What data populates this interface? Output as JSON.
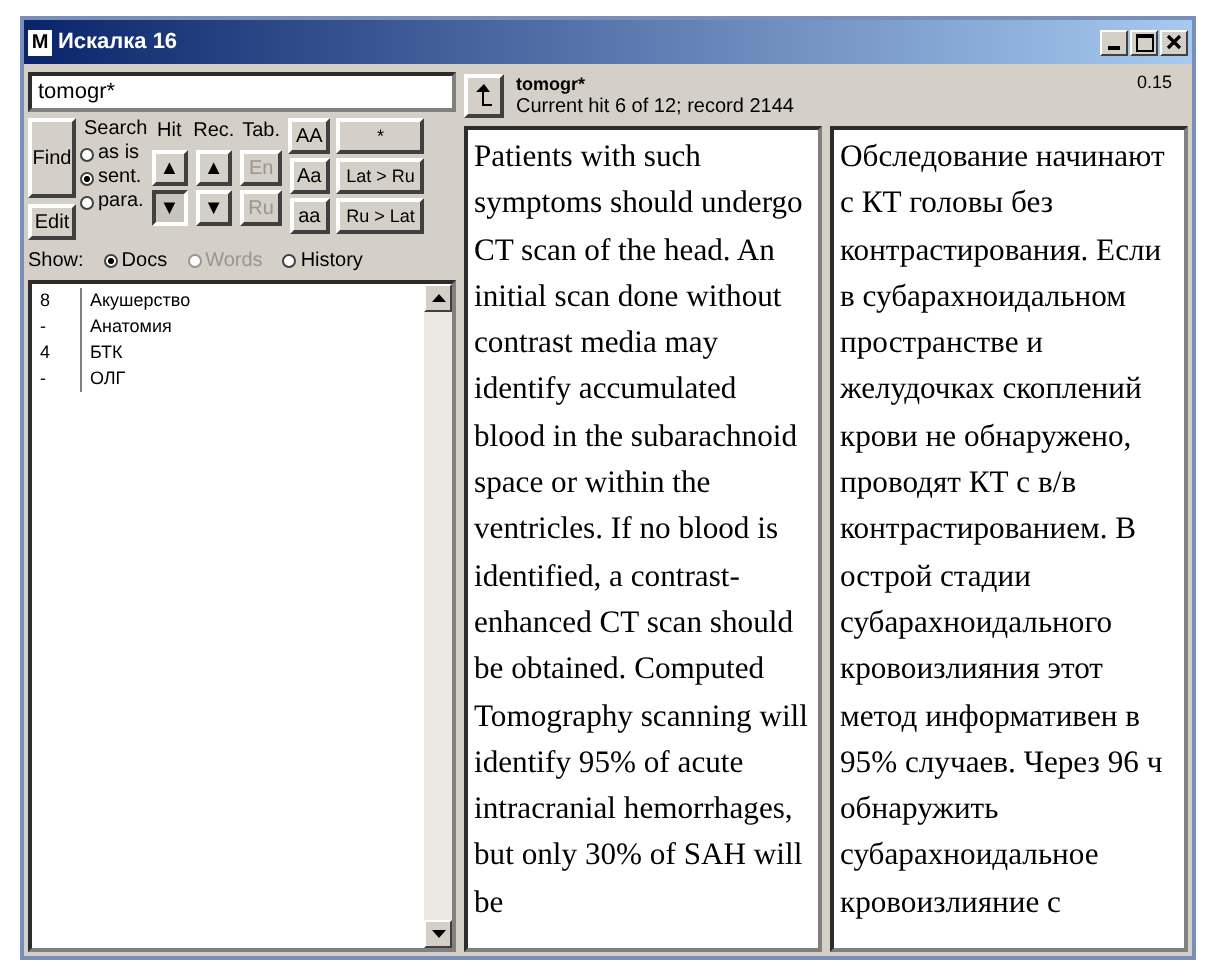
{
  "window": {
    "title": "Искалка 16",
    "app_icon": "M"
  },
  "search": {
    "value": "tomogr*"
  },
  "find_button": "Find",
  "edit_button": "Edit",
  "search_mode": {
    "label": "Search",
    "options": [
      {
        "label": "as is",
        "selected": false
      },
      {
        "label": "sent.",
        "selected": true
      },
      {
        "label": "para.",
        "selected": false
      }
    ]
  },
  "nav_groups": [
    {
      "label": "Hit",
      "buttons": [
        {
          "label": "▲",
          "pressed": false,
          "disabled": false
        },
        {
          "label": "▼",
          "pressed": true,
          "disabled": false
        }
      ]
    },
    {
      "label": "Rec.",
      "buttons": [
        {
          "label": "▲",
          "pressed": false,
          "disabled": false
        },
        {
          "label": "▼",
          "pressed": false,
          "disabled": false
        }
      ]
    },
    {
      "label": "Tab.",
      "buttons": [
        {
          "label": "En",
          "pressed": false,
          "disabled": true
        },
        {
          "label": "Ru",
          "pressed": false,
          "disabled": true
        }
      ]
    },
    {
      "buttons": [
        {
          "label": "AA",
          "pressed": false,
          "disabled": false
        },
        {
          "label": "Aa",
          "pressed": false,
          "disabled": false
        },
        {
          "label": "aa",
          "pressed": false,
          "disabled": false
        }
      ]
    },
    {
      "buttons": [
        {
          "label": "*",
          "pressed": false,
          "disabled": false
        },
        {
          "label": "Lat > Ru",
          "pressed": false,
          "disabled": false
        },
        {
          "label": "Ru > Lat",
          "pressed": false,
          "disabled": false
        }
      ]
    }
  ],
  "show": {
    "label": "Show:",
    "options": [
      {
        "label": "Docs",
        "selected": true,
        "disabled": false
      },
      {
        "label": "Words",
        "selected": false,
        "disabled": true
      },
      {
        "label": "History",
        "selected": false,
        "disabled": false
      }
    ]
  },
  "doc_list": [
    {
      "count": "8",
      "name": "Акушерство"
    },
    {
      "count": "-",
      "name": "Анатомия"
    },
    {
      "count": "4",
      "name": "БТК"
    },
    {
      "count": "-",
      "name": "ОЛГ"
    }
  ],
  "hit_header": {
    "query": "tomogr*",
    "status": "Current hit 6 of 12; record 2144",
    "time": "0.15"
  },
  "panes": [
    {
      "text": "Patients with such symptoms should undergo CT scan of the head. An initial scan done without contrast media may identify accumulated blood in the subarachnoid space or within the ventricles. If no blood is identified, a contrast-enhanced CT scan should be obtained. Computed Tomography scanning will identify 95% of acute intracranial hemorrhages, but only 30% of SAH will be"
    },
    {
      "text": "Обследование начинают с КТ головы без контрастирования. Если в субарахноидальном пространстве и желудочках скоплений крови не обнаружено, проводят КТ с в/в контрастированием. В острой стадии субарахноидального кровоизлияния этот метод информативен в 95% случаев. Через 96 ч обнаружить субарахноидальное кровоизлияние с"
    }
  ]
}
